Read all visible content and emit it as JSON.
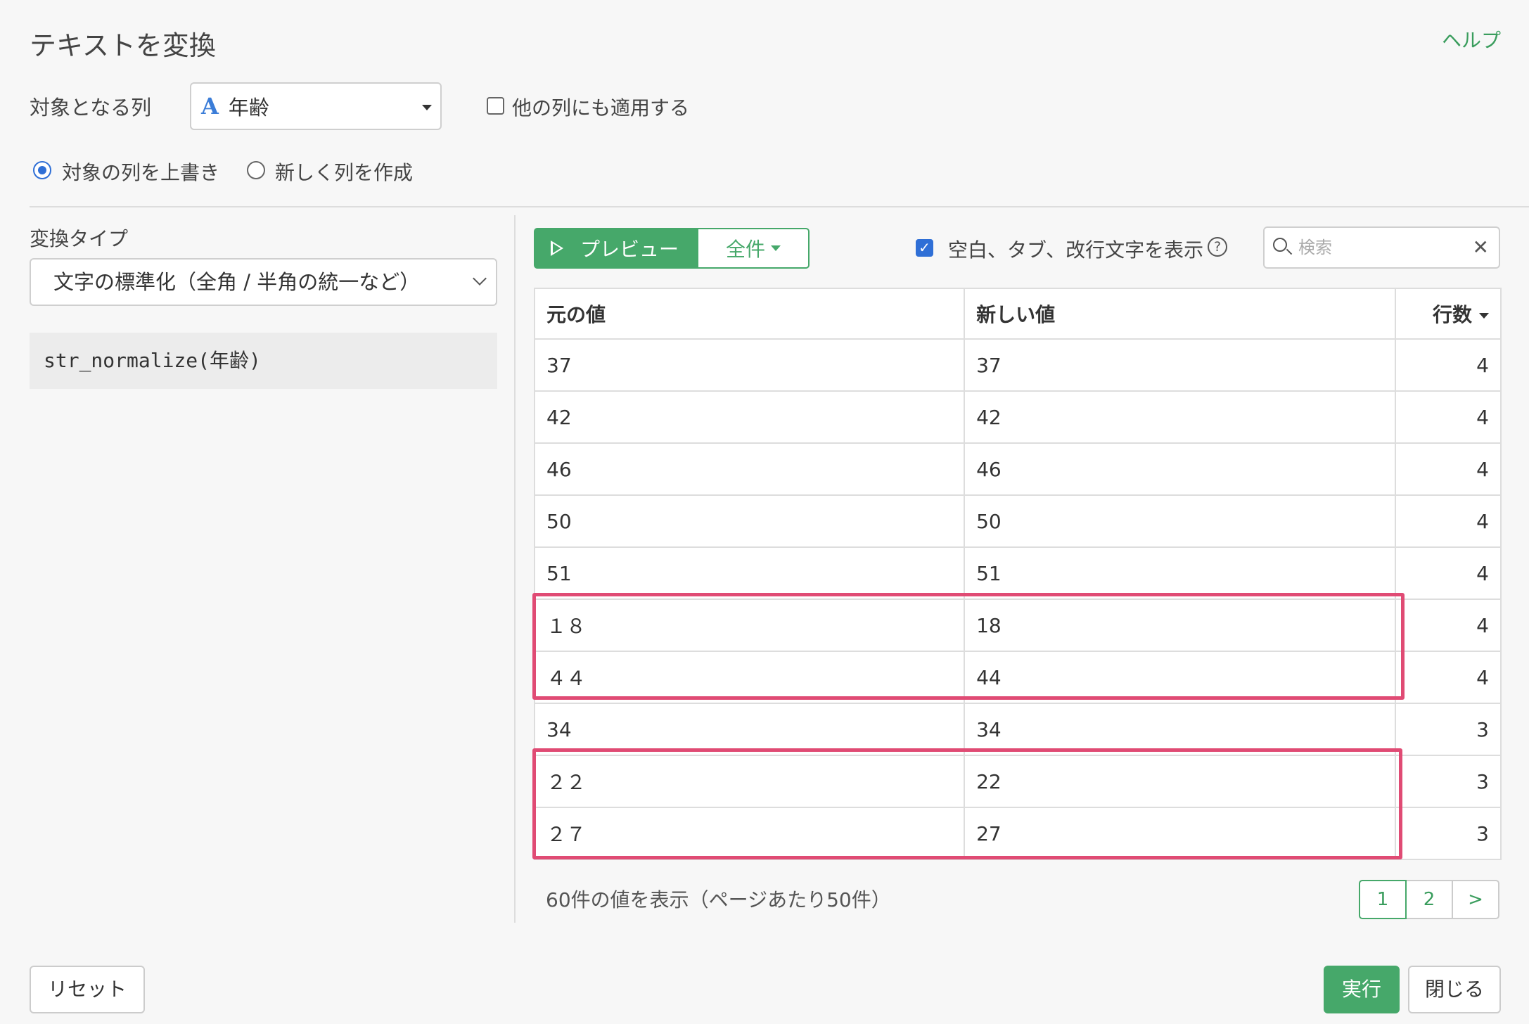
{
  "dialog": {
    "title": "テキストを変換",
    "help_label": "ヘルプ"
  },
  "target": {
    "label": "対象となる列",
    "column_type_icon": "A",
    "column_name": "年齢",
    "apply_other_label": "他の列にも適用する",
    "apply_other_checked": false
  },
  "output_mode": {
    "overwrite_label": "対象の列を上書き",
    "new_column_label": "新しく列を作成",
    "selected": "overwrite"
  },
  "conversion": {
    "type_label": "変換タイプ",
    "type_value": "文字の標準化（全角 / 半角の統一など）",
    "expression": "str_normalize(年齢)"
  },
  "preview": {
    "preview_label": "プレビュー",
    "scope_label": "全件",
    "show_whitespace_label": "空白、タブ、改行文字を表示",
    "show_whitespace_checked": true,
    "help_icon_text": "?",
    "search_placeholder": "検索",
    "clear_icon_text": "✕"
  },
  "table": {
    "headers": {
      "original": "元の値",
      "new": "新しい値",
      "count": "行数"
    },
    "rows": [
      {
        "original": "37",
        "new": "37",
        "count": "4"
      },
      {
        "original": "42",
        "new": "42",
        "count": "4"
      },
      {
        "original": "46",
        "new": "46",
        "count": "4"
      },
      {
        "original": "50",
        "new": "50",
        "count": "4"
      },
      {
        "original": "51",
        "new": "51",
        "count": "4"
      },
      {
        "original": "１８",
        "new": "18",
        "count": "4"
      },
      {
        "original": "４４",
        "new": "44",
        "count": "4"
      },
      {
        "original": "34",
        "new": "34",
        "count": "3"
      },
      {
        "original": "２２",
        "new": "22",
        "count": "3"
      },
      {
        "original": "２７",
        "new": "27",
        "count": "3"
      }
    ]
  },
  "footer": {
    "page_info": "60件の値を表示（ページあたり50件）",
    "pages": [
      "1",
      "2",
      ">"
    ],
    "active_page": "1",
    "reset_label": "リセット",
    "run_label": "実行",
    "close_label": "閉じる"
  },
  "colors": {
    "accent_green": "#46a86a",
    "highlight_red": "#e04b74",
    "check_blue": "#2f6fd6"
  }
}
